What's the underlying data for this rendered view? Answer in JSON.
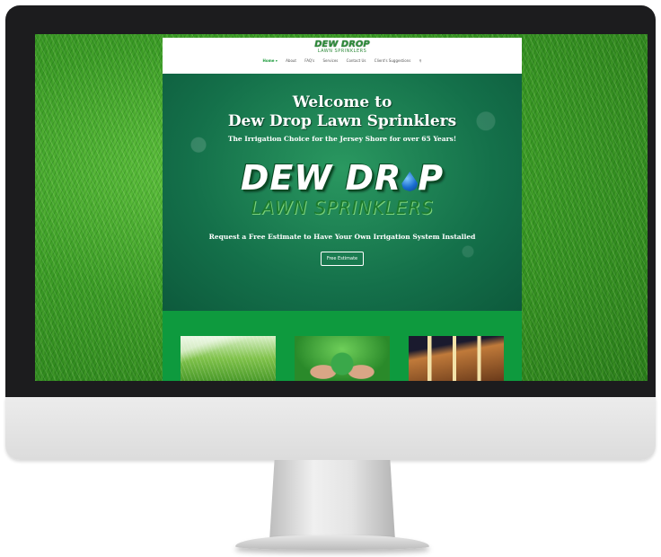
{
  "header": {
    "logo_line1": "DEW DROP",
    "logo_line2": "LAWN SPRINKLERS",
    "nav": [
      "Home ▾",
      "About",
      "FAQ's",
      "Services",
      "Contact Us",
      "Client's Suggestions"
    ]
  },
  "hero": {
    "title_line1": "Welcome to",
    "title_line2": "Dew Drop Lawn Sprinklers",
    "tagline": "The Irrigation Choice for the Jersey Shore for over 65 Years!",
    "logo_word1": "DEW DR",
    "logo_word1_end": "P",
    "logo_word2": "LAWN SPRINKLERS",
    "request": "Request a Free Estimate to Have Your Own Irrigation System Installed",
    "button": "Free Estimate"
  },
  "colors": {
    "site_green": "#0e8a3c",
    "nav_active": "#1a9a3a",
    "drop_blue": "#1a6ed0"
  },
  "icons": {
    "search": "search-icon",
    "drop": "water-drop-icon"
  }
}
